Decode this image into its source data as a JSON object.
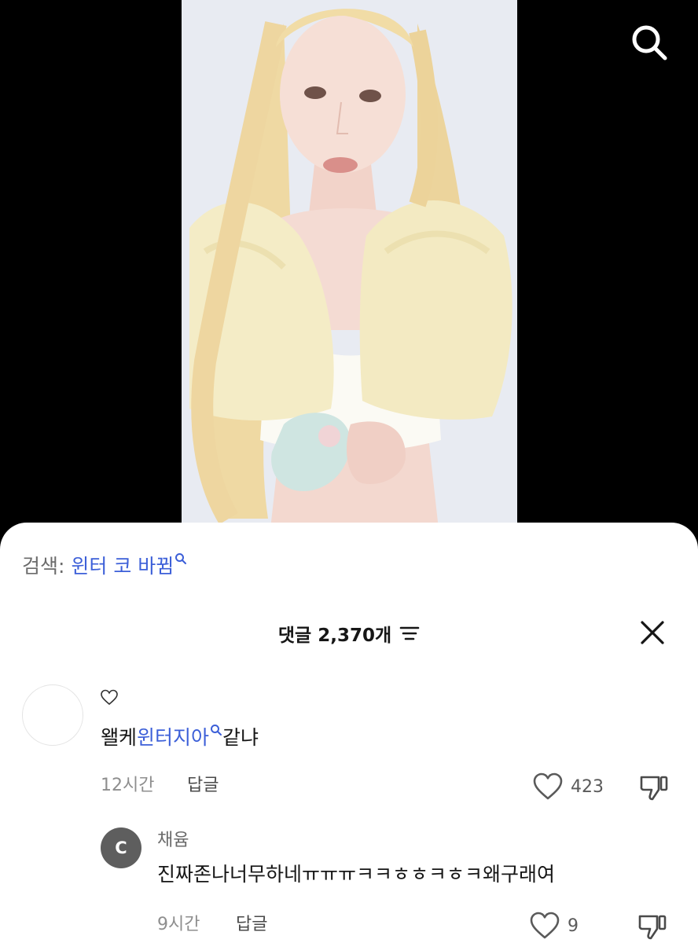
{
  "video": {
    "search_icon": "search-icon"
  },
  "search_suggestion": {
    "prefix": "검색: ",
    "term": "윈터 코 바뀜",
    "icon": "mini-search-icon"
  },
  "comments_header": {
    "title": "댓글 2,370개",
    "sort_icon": "sort-icon",
    "close_icon": "close-icon"
  },
  "comments": [
    {
      "text_before": "왤케",
      "keyword": "윈터지아",
      "text_after": "같냐",
      "time": "12시간",
      "reply_label": "답글",
      "likes": "423",
      "heart_icon": "heart-outline-icon",
      "dislike_icon": "thumbs-down-icon"
    }
  ],
  "replies": [
    {
      "avatar_letter": "C",
      "author": "채윰",
      "text": "진짜존나너무하네ㅠㅠㅠㅋㅋㅎㅎㅋㅎㅋ왜구래여",
      "time": "9시간",
      "reply_label": "답글",
      "likes": "9",
      "avatar_color": "#5e5e5e"
    }
  ],
  "colors": {
    "keyword": "#3c5fd8",
    "sheet_bg": "#ffffff",
    "video_bg": "#000000"
  }
}
